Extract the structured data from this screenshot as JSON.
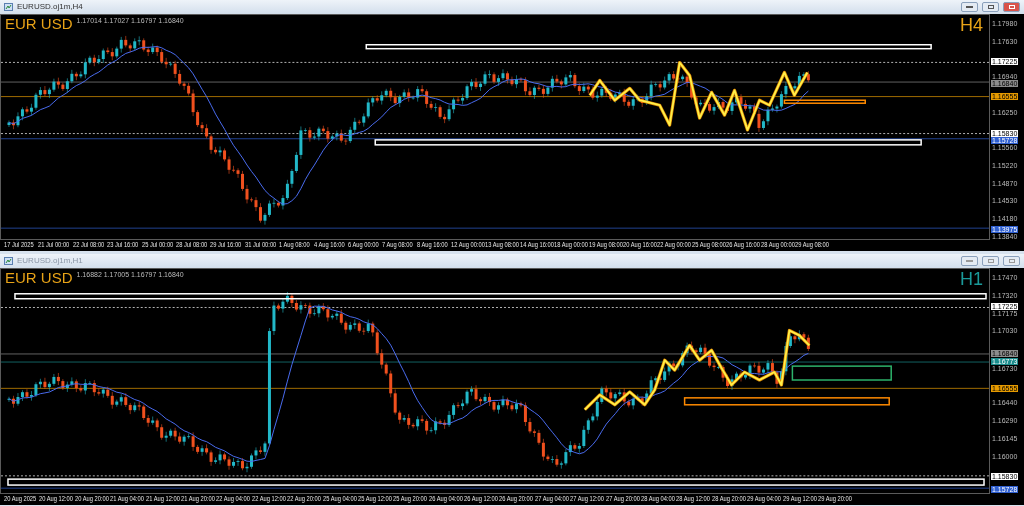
{
  "windows": [
    {
      "title": "EURUSD.oj1m,H4",
      "active": true,
      "symbol_label": "EUR USD",
      "timeframe_label": "H4",
      "ohlc": "1.17014 1.17027 1.16797 1.16840",
      "price_axis": [
        {
          "text": "1.17980",
          "kind": "tick"
        },
        {
          "text": "1.17630",
          "kind": "tick"
        },
        {
          "text": "1.17225",
          "kind": "tag",
          "color": "#ffffff"
        },
        {
          "text": "1.16940",
          "kind": "tick"
        },
        {
          "text": "1.16840",
          "kind": "tag",
          "color": "#8c8c8c"
        },
        {
          "text": "1.16555",
          "kind": "tag",
          "color": "#e59a00"
        },
        {
          "text": "1.16250",
          "kind": "tick"
        },
        {
          "text": "1.15830",
          "kind": "tag",
          "color": "#ffffff"
        },
        {
          "text": "1.15728",
          "kind": "tag",
          "color": "#2f5fd0"
        },
        {
          "text": "1.15560",
          "kind": "tick"
        },
        {
          "text": "1.15220",
          "kind": "tick"
        },
        {
          "text": "1.14870",
          "kind": "tick"
        },
        {
          "text": "1.14530",
          "kind": "tick"
        },
        {
          "text": "1.14180",
          "kind": "tick"
        },
        {
          "text": "1.13975",
          "kind": "tag",
          "color": "#2f5fd0"
        },
        {
          "text": "1.13840",
          "kind": "tick"
        }
      ],
      "time_axis": [
        "17 Jul 2025",
        "21 Jul 00:00",
        "22 Jul 08:00",
        "23 Jul 16:00",
        "25 Jul 00:00",
        "28 Jul 08:00",
        "29 Jul 16:00",
        "31 Jul 00:00",
        "1 Aug 08:00",
        "4 Aug 16:00",
        "6 Aug 00:00",
        "7 Aug 08:00",
        "8 Aug 16:00",
        "12 Aug 00:00",
        "13 Aug 08:00",
        "14 Aug 16:00",
        "18 Aug 00:00",
        "19 Aug 08:00",
        "20 Aug 16:00",
        "22 Aug 00:00",
        "25 Aug 08:00",
        "26 Aug 16:00",
        "28 Aug 00:00",
        "29 Aug 08:00"
      ]
    },
    {
      "title": "EURUSD.oj1m,H1",
      "active": false,
      "symbol_label": "EUR USD",
      "timeframe_label": "H1",
      "ohlc": "1.16882 1.17005 1.16797 1.16840",
      "price_axis": [
        {
          "text": "1.17470",
          "kind": "tick"
        },
        {
          "text": "1.17320",
          "kind": "tick"
        },
        {
          "text": "1.17225",
          "kind": "tag",
          "color": "#ffffff"
        },
        {
          "text": "1.17175",
          "kind": "tick"
        },
        {
          "text": "1.17030",
          "kind": "tick"
        },
        {
          "text": "1.16840",
          "kind": "tag",
          "color": "#8c8c8c"
        },
        {
          "text": "1.16773",
          "kind": "tag",
          "color": "#1a8c8c"
        },
        {
          "text": "1.16730",
          "kind": "tick"
        },
        {
          "text": "1.16555",
          "kind": "tag",
          "color": "#e59a00"
        },
        {
          "text": "1.16440",
          "kind": "tick"
        },
        {
          "text": "1.16290",
          "kind": "tick"
        },
        {
          "text": "1.16145",
          "kind": "tick"
        },
        {
          "text": "1.16000",
          "kind": "tick"
        },
        {
          "text": "1.15830",
          "kind": "tag",
          "color": "#ffffff"
        },
        {
          "text": "1.15728",
          "kind": "tag",
          "color": "#2f5fd0"
        }
      ],
      "time_axis": [
        "20 Aug 2025",
        "20 Aug 12:00",
        "20 Aug 20:00",
        "21 Aug 04:00",
        "21 Aug 12:00",
        "21 Aug 20:00",
        "22 Aug 04:00",
        "22 Aug 12:00",
        "22 Aug 20:00",
        "25 Aug 04:00",
        "25 Aug 12:00",
        "25 Aug 20:00",
        "26 Aug 04:00",
        "26 Aug 12:00",
        "26 Aug 20:00",
        "27 Aug 04:00",
        "27 Aug 12:00",
        "27 Aug 20:00",
        "28 Aug 04:00",
        "28 Aug 12:00",
        "28 Aug 20:00",
        "29 Aug 04:00",
        "29 Aug 12:00",
        "29 Aug 20:00"
      ]
    }
  ]
}
